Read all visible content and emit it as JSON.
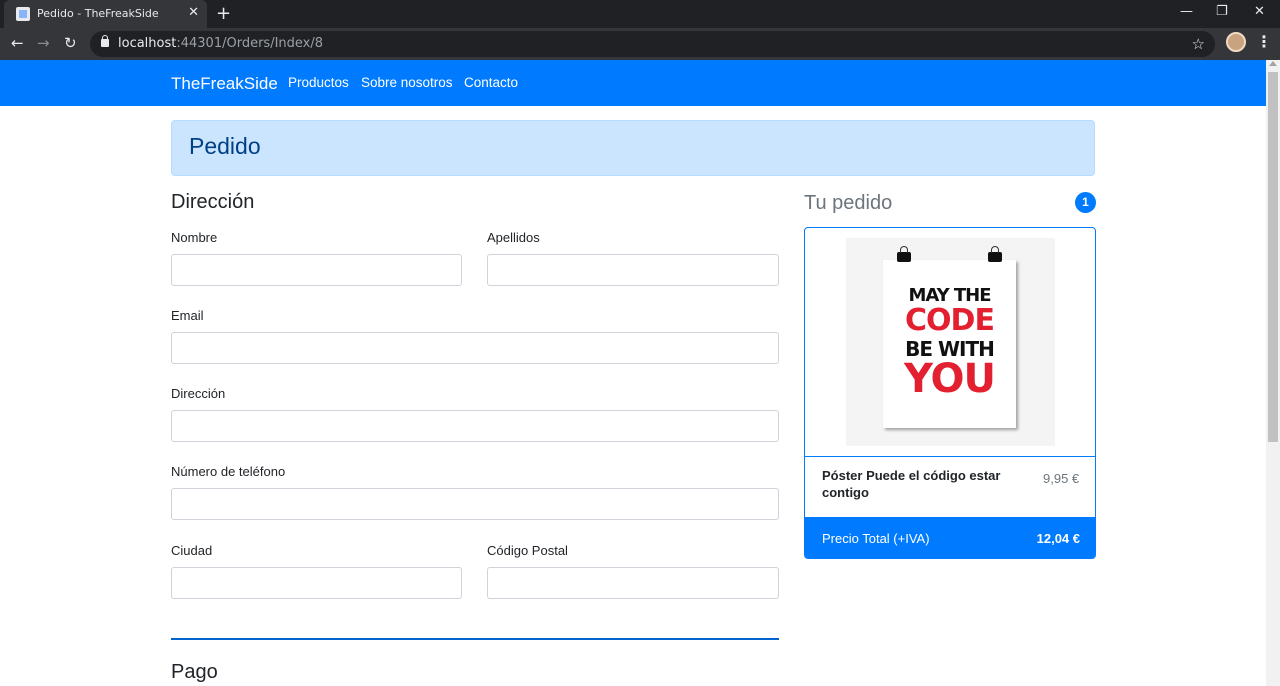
{
  "browser": {
    "tab_title": "Pedido - TheFreakSide",
    "tab_close": "✕",
    "new_tab": "+",
    "window_controls": {
      "minimize": "—",
      "maximize": "❐",
      "close": "✕"
    },
    "nav": {
      "back": "←",
      "forward": "→",
      "reload": "↻"
    },
    "url_host": "localhost",
    "url_path": ":44301/Orders/Index/8",
    "star": "☆",
    "menu": "⋮"
  },
  "navbar": {
    "brand": "TheFreakSide",
    "links": [
      "Productos",
      "Sobre nosotros",
      "Contacto"
    ]
  },
  "page": {
    "title": "Pedido",
    "address_section": {
      "heading": "Dirección",
      "fields": {
        "nombre": {
          "label": "Nombre",
          "value": ""
        },
        "apellidos": {
          "label": "Apellidos",
          "value": ""
        },
        "email": {
          "label": "Email",
          "value": ""
        },
        "direccion": {
          "label": "Dirección",
          "value": ""
        },
        "telefono": {
          "label": "Número de teléfono",
          "value": ""
        },
        "ciudad": {
          "label": "Ciudad",
          "value": ""
        },
        "codigo_postal": {
          "label": "Código Postal",
          "value": ""
        }
      }
    },
    "payment_section": {
      "heading": "Pago"
    }
  },
  "order": {
    "title": "Tu pedido",
    "count": "1",
    "item": {
      "poster_lines": [
        "MAY THE",
        "CODE",
        "BE WITH",
        "YOU"
      ],
      "name": "Póster Puede el código estar contigo",
      "price": "9,95 €"
    },
    "total_label": "Precio Total (+IVA)",
    "total_value": "12,04 €"
  },
  "colors": {
    "primary": "#007bff",
    "alert_bg": "#cce5ff",
    "alert_text": "#004085",
    "poster_red": "#e3202f"
  }
}
